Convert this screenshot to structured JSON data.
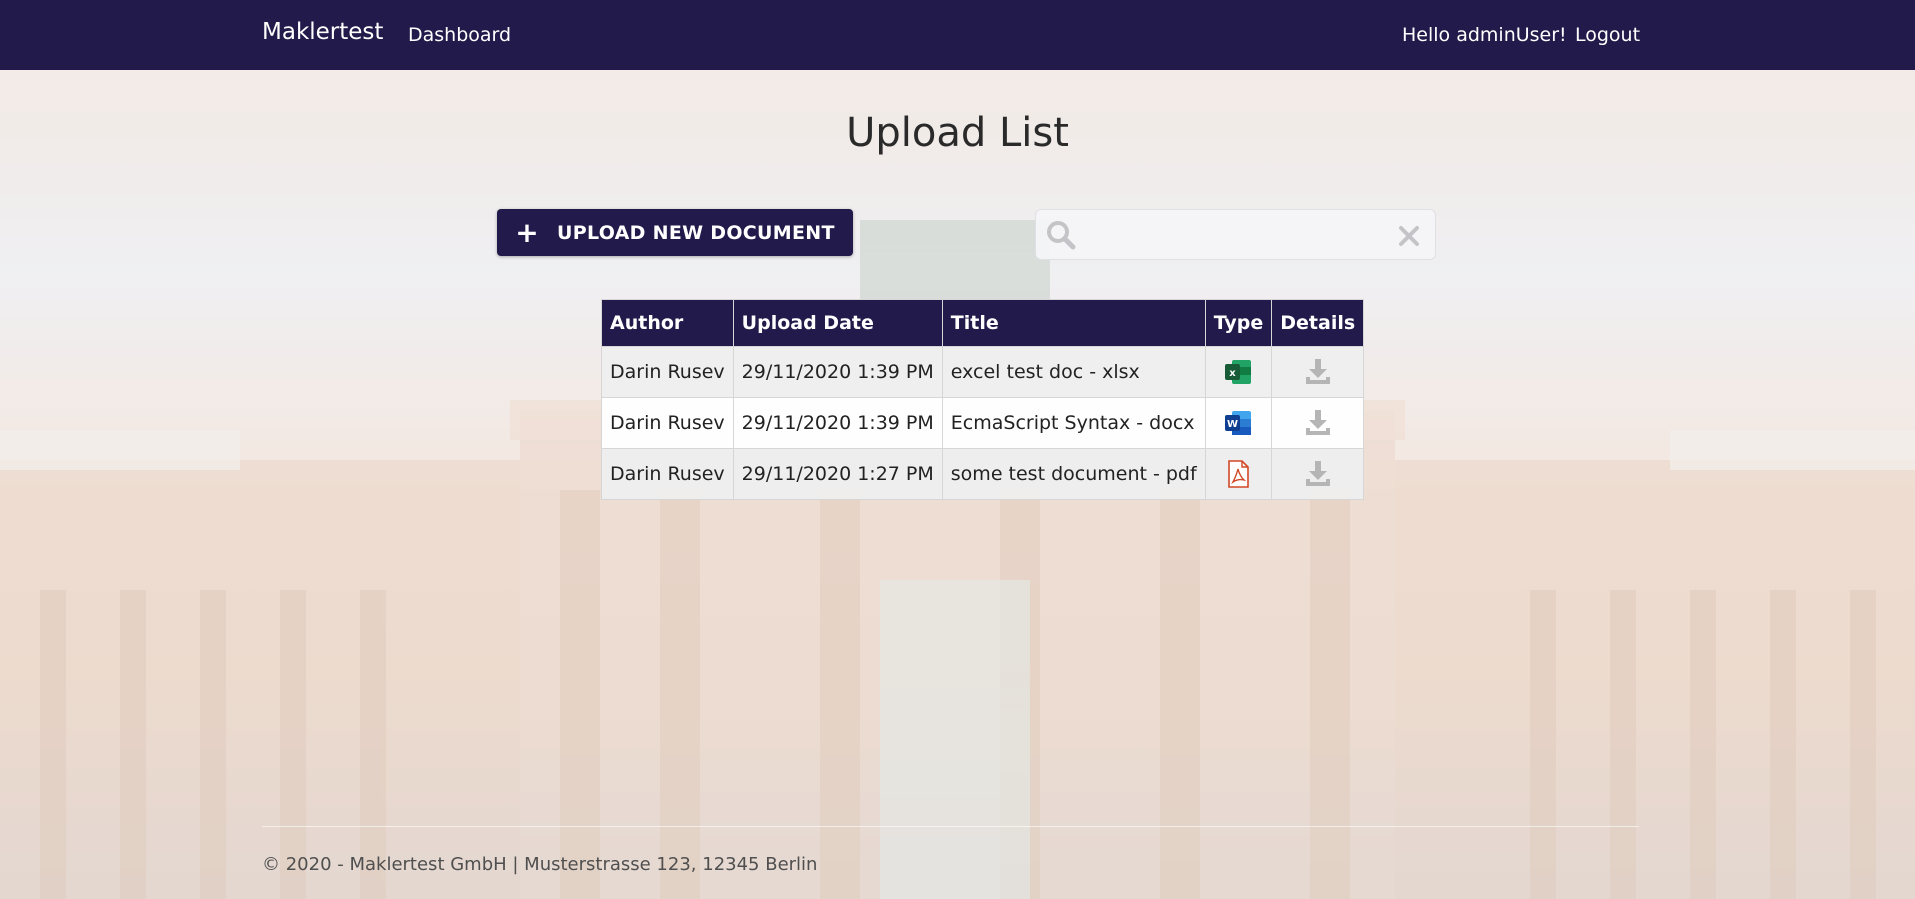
{
  "nav": {
    "brand": "Maklertest",
    "dashboard": "Dashboard",
    "greeting": "Hello adminUser!",
    "logout": "Logout"
  },
  "page": {
    "title": "Upload List"
  },
  "upload_button": {
    "label": "UPLOAD NEW DOCUMENT",
    "icon": "plus-icon"
  },
  "search": {
    "value": "",
    "placeholder": "",
    "icon": "search-icon",
    "clear_icon": "clear-icon"
  },
  "table": {
    "headers": {
      "author": "Author",
      "upload_date": "Upload Date",
      "title": "Title",
      "type": "Type",
      "details": "Details"
    },
    "rows": [
      {
        "author": "Darin Rusev",
        "upload_date": "29/11/2020 1:39 PM",
        "title": "excel test doc - xlsx",
        "type_icon": "excel-file-icon",
        "details_icon": "download-icon"
      },
      {
        "author": "Darin Rusev",
        "upload_date": "29/11/2020 1:39 PM",
        "title": "EcmaScript Syntax - docx",
        "type_icon": "word-file-icon",
        "details_icon": "download-icon"
      },
      {
        "author": "Darin Rusev",
        "upload_date": "29/11/2020 1:27 PM",
        "title": "some test document - pdf",
        "type_icon": "pdf-file-icon",
        "details_icon": "download-icon"
      }
    ]
  },
  "footer": {
    "text": "© 2020 - Maklertest GmbH | Musterstrasse 123, 12345 Berlin"
  },
  "colors": {
    "navbar": "#221a4a",
    "button": "#221a4a",
    "excel": "#1e7145",
    "word": "#2b579a",
    "pdf": "#d24726"
  }
}
